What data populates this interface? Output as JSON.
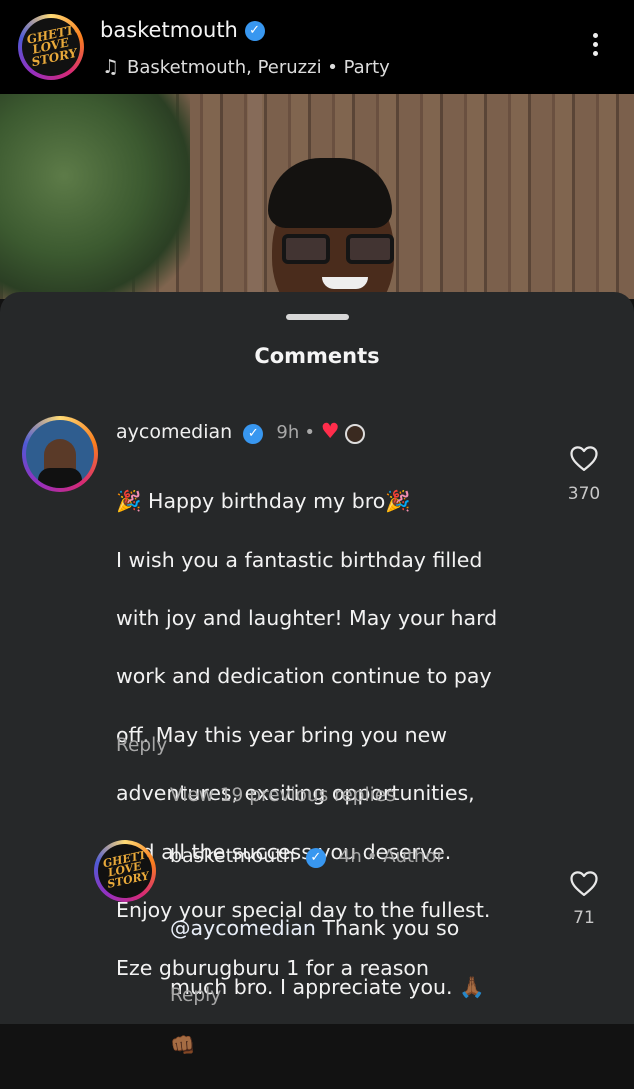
{
  "header": {
    "username": "basketmouth",
    "audio": "Basketmouth, Peruzzi • Party",
    "avatar_logo": "GHETTO LOVE STORY"
  },
  "sheet": {
    "title": "Comments"
  },
  "comment": {
    "username": "aycomedian",
    "time": "9h",
    "lines": [
      "🎉 Happy birthday my bro🎉",
      "I wish you a fantastic birthday filled",
      "with joy and laughter! May your hard",
      "work and dedication continue to pay",
      "off. May this year bring you new",
      "adventures, exciting opportunities,",
      "and all the success you deserve.",
      "Enjoy your special day to the fullest.",
      "Eze gburugburu 1 for a reason"
    ],
    "reply_label": "Reply",
    "likes": "370"
  },
  "view_replies": "View 19 previous replies",
  "reply": {
    "username": "basketmouth",
    "time": "4h",
    "author_label": "Author",
    "mention": "@aycomedian",
    "text_line1": " Thank you so",
    "text_line2": "much bro. I appreciate you. 🙏🏾",
    "text_line3": "👊🏾",
    "reply_label": "Reply",
    "likes": "71"
  },
  "colors": {
    "verified": "#3897f0",
    "sheet_bg": "#262829",
    "meta_text": "#a8a8a8"
  }
}
